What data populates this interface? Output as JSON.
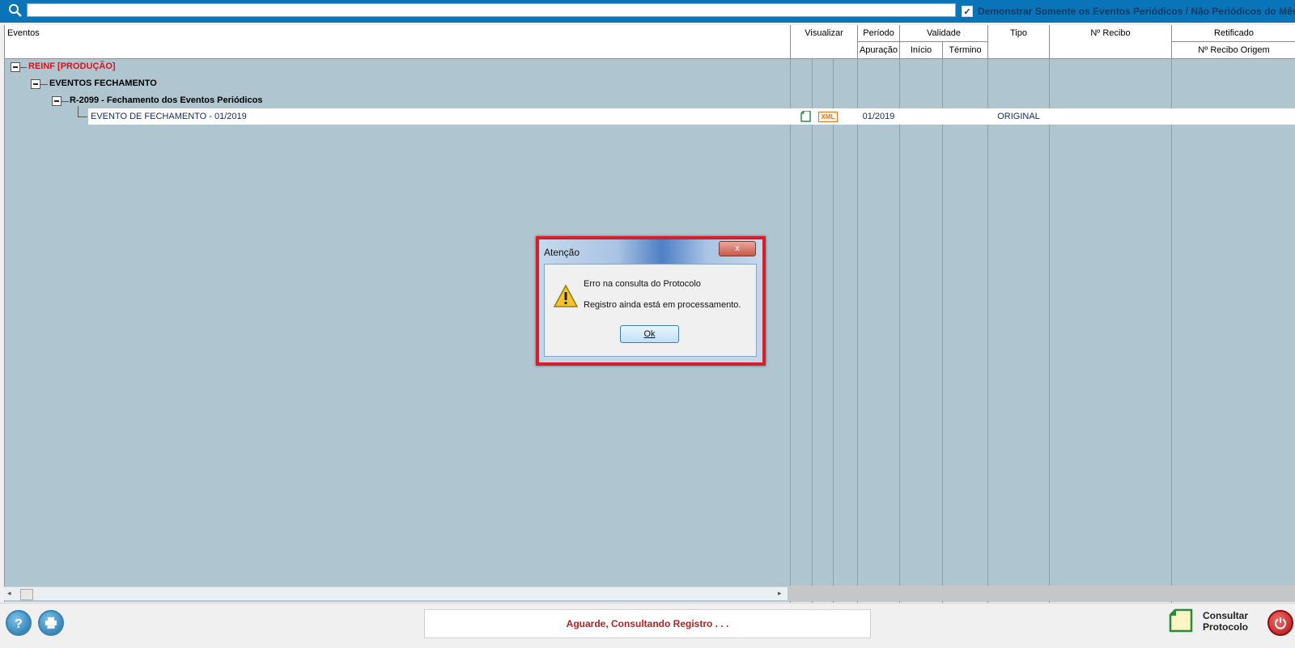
{
  "search": {
    "placeholder": "",
    "value": ""
  },
  "filter": {
    "checked": true,
    "label": "Demonstrar Somente os Eventos Periódicos / Não Periódicos do Mês"
  },
  "headers": {
    "eventos": "Eventos",
    "visualizar": "Visualizar",
    "periodo": "Período",
    "apuracao": "Apuração",
    "validade": "Validade",
    "inicio": "Início",
    "termino": "Término",
    "tipo": "Tipo",
    "recibo": "Nº Recibo",
    "retificado": "Retificado",
    "recibo_origem": "Nº Recibo Origem"
  },
  "tree": {
    "root": "REINF [PRODUÇÃO]",
    "group": "EVENTOS FECHAMENTO",
    "subgroup": "R-2099 - Fechamento dos Eventos Periódicos",
    "leaf": {
      "label": "EVENTO DE FECHAMENTO - 01/2019",
      "xml_icon_text": "XML",
      "periodo": "01/2019",
      "tipo": "ORIGINAL"
    }
  },
  "dialog": {
    "title": "Atenção",
    "close": "x",
    "line1": "Erro na consulta do Protocolo",
    "line2": "Registro ainda está em processamento.",
    "ok": "Ok"
  },
  "status": {
    "text": "Aguarde, Consultando Registro . . ."
  },
  "toolbar": {
    "consultar_line1": "Consultar",
    "consultar_line2": "Protocolo"
  },
  "icons": [
    "search-icon",
    "help-icon",
    "print-icon",
    "document-icon",
    "xml-icon",
    "warning-icon",
    "consult-protocol-icon",
    "power-icon"
  ],
  "colors": {
    "topbar": "#0a74b8",
    "grid_bg": "#afc5cf",
    "root_text": "#d8141b",
    "dialog_border": "#d81e2a",
    "status_text": "#b22222"
  }
}
